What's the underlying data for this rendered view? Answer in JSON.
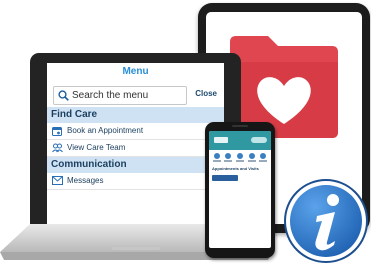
{
  "colors": {
    "folder_red": "#e0464f",
    "heart": "#ffffff",
    "menu_accent": "#2a8fd6",
    "section_bg": "#cfe2f3",
    "info_blue": "#1c5fb0"
  },
  "laptop": {
    "menu_title": "Menu",
    "search": {
      "placeholder": "Search the menu",
      "icon": "search-icon",
      "close_label": "Close"
    },
    "sections": [
      {
        "title": "Find Care",
        "items": [
          {
            "label": "Book an Appointment",
            "icon": "calendar-icon"
          },
          {
            "label": "View Care Team",
            "icon": "people-icon"
          }
        ]
      },
      {
        "title": "Communication",
        "items": [
          {
            "label": "Messages",
            "icon": "envelope-icon"
          }
        ]
      }
    ]
  },
  "phone": {
    "heading": "Appointments and Visits"
  },
  "decor": {
    "folder_icon": "heart-folder-icon",
    "info_icon": "info-icon"
  }
}
